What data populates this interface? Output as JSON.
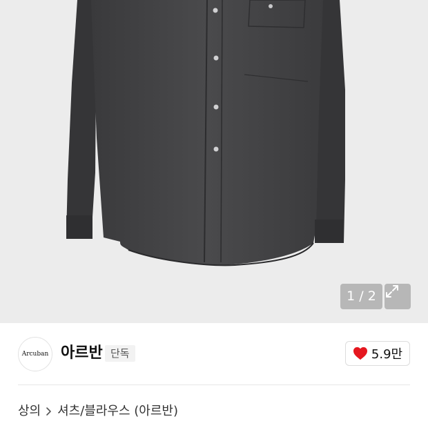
{
  "gallery": {
    "current_page": "1 / 2",
    "expand_icon": "expand-arrows-icon",
    "product_image": "dark-charcoal-button-down-shirt"
  },
  "brand": {
    "logo_text": "Arcuban",
    "name": "아르반",
    "badge": "단독"
  },
  "like": {
    "icon": "heart-icon",
    "icon_color": "#e5171f",
    "count": "5.9만"
  },
  "breadcrumb": {
    "items": [
      "상의",
      "셔츠/블라우스 (아르반)"
    ],
    "separator_icon": "chevron-right-icon"
  }
}
